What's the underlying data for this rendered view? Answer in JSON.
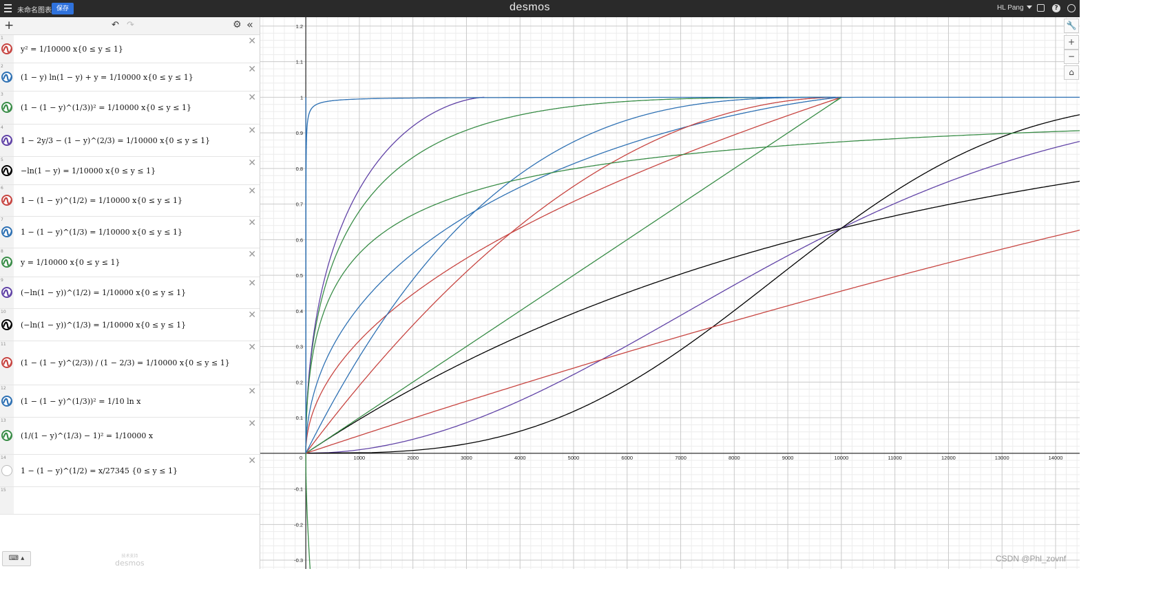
{
  "header": {
    "title": "未命名图表",
    "save_label": "保存",
    "logo": "desmos",
    "user": "HL Pang",
    "share_icon": "share-icon",
    "help_icon": "help-icon",
    "language_icon": "globe-icon"
  },
  "toolbar": {
    "add_icon": "plus-icon",
    "undo_icon": "undo-icon",
    "redo_icon": "redo-icon",
    "settings_icon": "gear-icon",
    "collapse_icon": "double-chevron-left-icon"
  },
  "expressions": [
    {
      "num": "1",
      "color": "#c74440",
      "latex": "y² = 1/10000 x{0 ≤ y ≤ 1}"
    },
    {
      "num": "2",
      "color": "#2d70b3",
      "latex": "(1 − y) ln(1 − y) + y = 1/10000 x{0 ≤ y ≤ 1}"
    },
    {
      "num": "3",
      "color": "#388c46",
      "latex": "(1 − (1 − y)^(1/3))² = 1/10000 x{0 ≤ y ≤ 1}"
    },
    {
      "num": "4",
      "color": "#6042a6",
      "latex": "1 − 2y/3 − (1 − y)^(2/3) = 1/10000 x{0 ≤ y ≤ 1}"
    },
    {
      "num": "5",
      "color": "#000000",
      "latex": "−ln(1 − y) = 1/10000 x{0 ≤ y ≤ 1}"
    },
    {
      "num": "6",
      "color": "#c74440",
      "latex": "1 − (1 − y)^(1/2) = 1/10000 x{0 ≤ y ≤ 1}"
    },
    {
      "num": "7",
      "color": "#2d70b3",
      "latex": "1 − (1 − y)^(1/3) = 1/10000 x{0 ≤ y ≤ 1}"
    },
    {
      "num": "8",
      "color": "#388c46",
      "latex": "y = 1/10000 x{0 ≤ y ≤ 1}"
    },
    {
      "num": "9",
      "color": "#6042a6",
      "latex": "(−ln(1 − y))^(1/2) = 1/10000 x{0 ≤ y ≤ 1}"
    },
    {
      "num": "10",
      "color": "#000000",
      "latex": "(−ln(1 − y))^(1/3) = 1/10000 x{0 ≤ y ≤ 1}"
    },
    {
      "num": "11",
      "color": "#c74440",
      "latex": "(1 − (1 − y)^(2/3)) / (1 − 2/3) = 1/10000 x{0 ≤ y ≤ 1}"
    },
    {
      "num": "12",
      "color": "#2d70b3",
      "latex": "(1 − (1 − y)^(1/3))² = 1/10 ln x"
    },
    {
      "num": "13",
      "color": "#388c46",
      "latex": "(1/(1 − y)^(1/3) − 1)² = 1/10000 x"
    },
    {
      "num": "14",
      "color": "#bbbbbb",
      "latex": "1 − (1 − y)^(1/2) = x/27345 {0 ≤ y ≤ 1}"
    },
    {
      "num": "15",
      "color": "",
      "latex": ""
    }
  ],
  "footer": {
    "keyboard_icon": "keyboard-icon",
    "powered_small": "技术支持",
    "powered": "desmos"
  },
  "graph_controls": {
    "wrench_icon": "wrench-icon",
    "zoom_in": "+",
    "zoom_out": "−",
    "home_icon": "home-icon"
  },
  "watermark": "CSDN @Phl_zovnf",
  "chart_data": {
    "type": "line",
    "xlim": [
      -850,
      14450
    ],
    "ylim": [
      -0.325,
      1.225
    ],
    "grid": true,
    "x_ticks": [
      "0",
      "1000",
      "2000",
      "3000",
      "4000",
      "5000",
      "6000",
      "7000",
      "8000",
      "9000",
      "10000",
      "11000",
      "12000",
      "13000",
      "14000"
    ],
    "y_ticks": [
      "1.2",
      "1.1",
      "1",
      "0.9",
      "0.8",
      "0.7",
      "0.6",
      "0.5",
      "0.4",
      "0.3",
      "0.2",
      "0.1",
      "-0.1",
      "-0.2",
      "-0.3"
    ],
    "series": [
      {
        "color": "#c74440",
        "kind": "f1"
      },
      {
        "color": "#2d70b3",
        "kind": "f2"
      },
      {
        "color": "#388c46",
        "kind": "f3"
      },
      {
        "color": "#6042a6",
        "kind": "f4"
      },
      {
        "color": "#000000",
        "kind": "f5"
      },
      {
        "color": "#c74440",
        "kind": "f6"
      },
      {
        "color": "#2d70b3",
        "kind": "f7"
      },
      {
        "color": "#388c46",
        "kind": "f8"
      },
      {
        "color": "#6042a6",
        "kind": "f9"
      },
      {
        "color": "#000000",
        "kind": "f10"
      },
      {
        "color": "#c74440",
        "kind": "f11"
      },
      {
        "color": "#2d70b3",
        "kind": "f12"
      },
      {
        "color": "#388c46",
        "kind": "f13"
      }
    ]
  }
}
